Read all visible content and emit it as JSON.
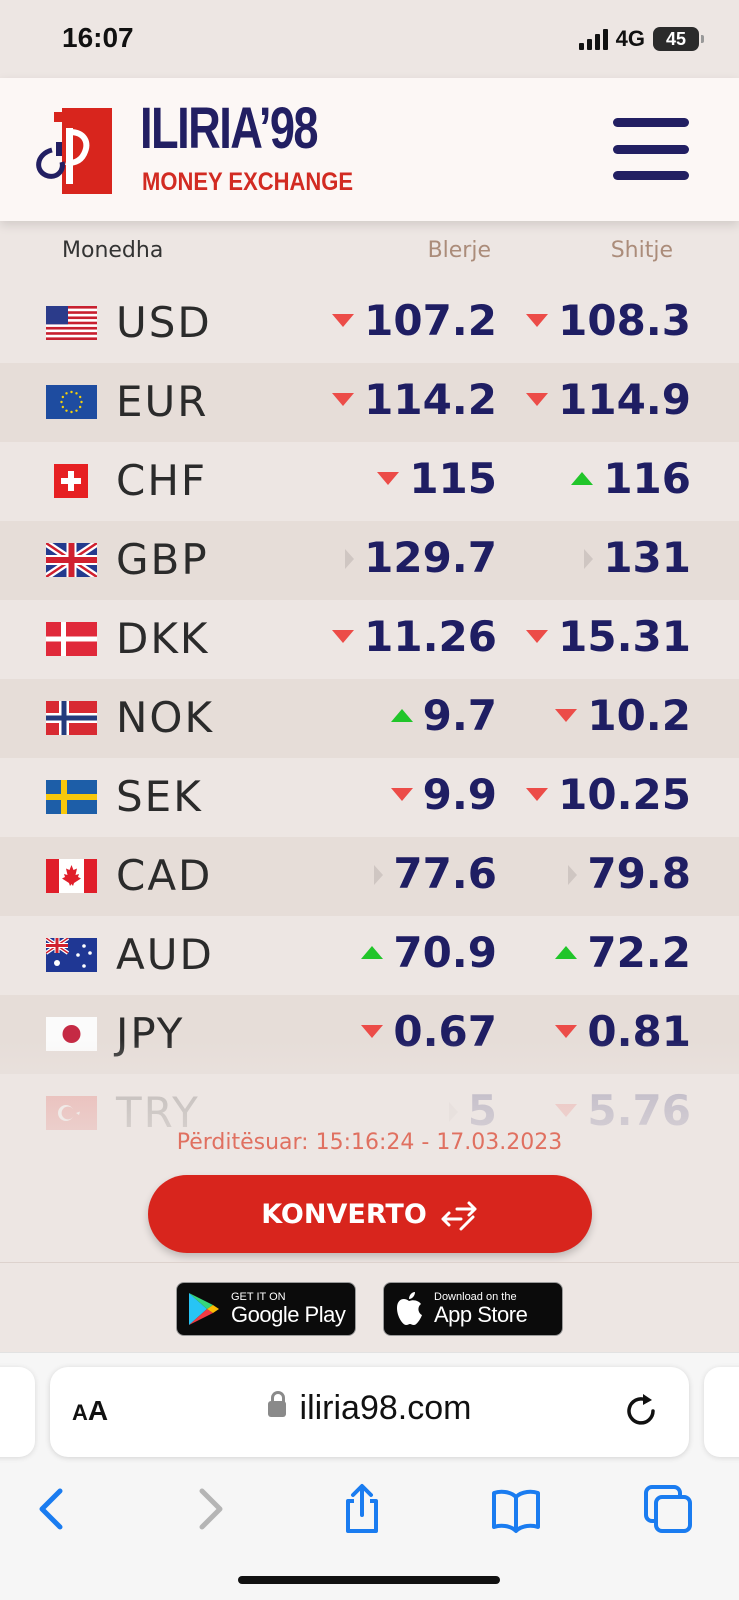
{
  "status": {
    "time": "16:07",
    "network": "4G",
    "battery": "45"
  },
  "header": {
    "brand": "ILIRIA’98",
    "subtitle": "MONEY EXCHANGE"
  },
  "table": {
    "col_currency": "Monedha",
    "col_buy": "Blerje",
    "col_sell": "Shitje",
    "rows": [
      {
        "code": "USD",
        "flag": "us-flag-icon",
        "buy": "107.2",
        "buy_trend": "down",
        "sell": "108.3",
        "sell_trend": "down"
      },
      {
        "code": "EUR",
        "flag": "eu-flag-icon",
        "buy": "114.2",
        "buy_trend": "down",
        "sell": "114.9",
        "sell_trend": "down"
      },
      {
        "code": "CHF",
        "flag": "ch-flag-icon",
        "buy": "115",
        "buy_trend": "down",
        "sell": "116",
        "sell_trend": "up"
      },
      {
        "code": "GBP",
        "flag": "gb-flag-icon",
        "buy": "129.7",
        "buy_trend": "same",
        "sell": "131",
        "sell_trend": "same"
      },
      {
        "code": "DKK",
        "flag": "dk-flag-icon",
        "buy": "11.26",
        "buy_trend": "down",
        "sell": "15.31",
        "sell_trend": "down"
      },
      {
        "code": "NOK",
        "flag": "no-flag-icon",
        "buy": "9.7",
        "buy_trend": "up",
        "sell": "10.2",
        "sell_trend": "down"
      },
      {
        "code": "SEK",
        "flag": "se-flag-icon",
        "buy": "9.9",
        "buy_trend": "down",
        "sell": "10.25",
        "sell_trend": "down"
      },
      {
        "code": "CAD",
        "flag": "ca-flag-icon",
        "buy": "77.6",
        "buy_trend": "same",
        "sell": "79.8",
        "sell_trend": "same"
      },
      {
        "code": "AUD",
        "flag": "au-flag-icon",
        "buy": "70.9",
        "buy_trend": "up",
        "sell": "72.2",
        "sell_trend": "up"
      },
      {
        "code": "JPY",
        "flag": "jp-flag-icon",
        "buy": "0.67",
        "buy_trend": "down",
        "sell": "0.81",
        "sell_trend": "down"
      },
      {
        "code": "TRY",
        "flag": "tr-flag-icon",
        "buy": "5",
        "buy_trend": "same",
        "sell": "5.76",
        "sell_trend": "down"
      }
    ]
  },
  "updated_text": "Përditësuar: 15:16:24 - 17.03.2023",
  "convert_button": "KONVERTO",
  "stores": {
    "google_small": "GET IT ON",
    "google_big": "Google Play",
    "apple_small": "Download on the",
    "apple_big": "App Store"
  },
  "browser": {
    "aa_small": "A",
    "aa_big": "A",
    "url": "iliria98.com"
  },
  "colors": {
    "brand_navy": "#221f62",
    "brand_red": "#d8251d",
    "trend_up": "#21c52a",
    "trend_down": "#ec4c48"
  }
}
